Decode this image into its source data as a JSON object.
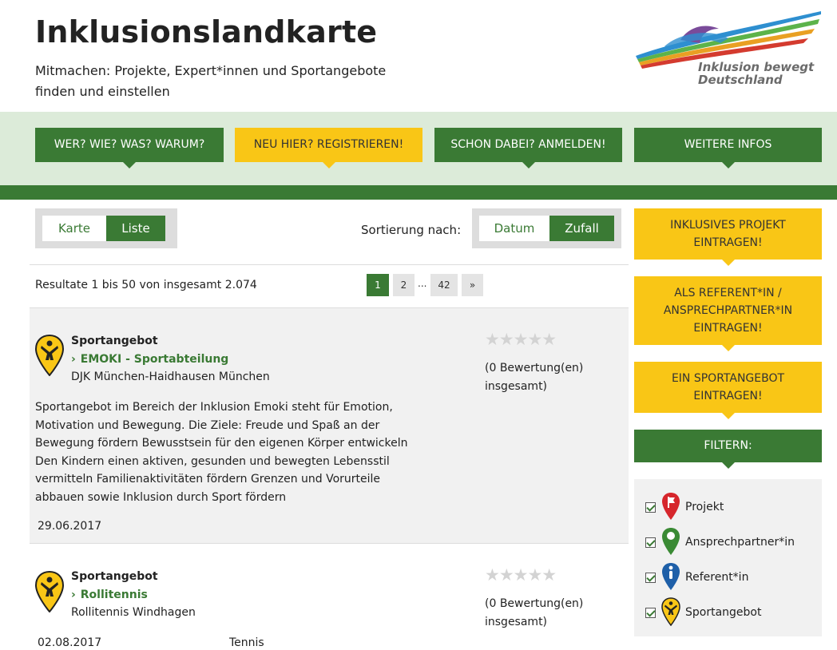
{
  "header": {
    "title": "Inklusionslandkarte",
    "subtitle": "Mitmachen: Projekte, Expert*innen und Sportangebote finden und einstellen",
    "logo_text_line1": "Inklusion bewegt",
    "logo_text_line2": "Deutschland"
  },
  "nav": {
    "items": [
      {
        "label": "WER? WIE? WAS? WARUM?"
      },
      {
        "label": "NEU HIER? REGISTRIEREN!"
      },
      {
        "label": "SCHON DABEI? ANMELDEN!"
      },
      {
        "label": "WEITERE INFOS"
      }
    ]
  },
  "view_toggle": {
    "map": "Karte",
    "list": "Liste",
    "active": "list"
  },
  "sort": {
    "label": "Sortierung nach:",
    "date": "Datum",
    "random": "Zufall",
    "active": "random"
  },
  "results": {
    "summary": "Resultate 1 bis 50 von insgesamt 2.074"
  },
  "pagination": {
    "pages": [
      "1",
      "2"
    ],
    "ellipsis": "...",
    "last": "42",
    "next": "»",
    "current": "1"
  },
  "listings": [
    {
      "type": "Sportangebot",
      "title": "EMOKI - Sportabteilung",
      "org": "DJK München-Haidhausen München",
      "description": "Sportangebot im Bereich der Inklusion Emoki steht für Emotion, Motivation und Bewegung. Die Ziele:    Freude und Spaß an der Bewegung fördern    Bewusstsein für den eigenen Körper entwickeln    Den Kindern einen aktiven, gesunden und bewegten Lebensstil vermitteln    Familienaktivitäten fördern    Grenzen und Vorurteile abbauen sowie Inklusion durch Sport fördern",
      "date": "29.06.2017",
      "stars": "★★★★★",
      "rating": "(0 Bewertung(en) insgesamt)",
      "rating_value": 0
    },
    {
      "type": "Sportangebot",
      "title": "Rollitennis",
      "org": "Rollitennis Windhagen",
      "date": "02.08.2017",
      "tag": "Tennis",
      "stars": "★★★★★",
      "rating": "(0 Bewertung(en) insgesamt)",
      "rating_value": 0
    }
  ],
  "sidebar": {
    "buttons": [
      {
        "label": "INKLUSIVES PROJEKT EINTRAGEN!"
      },
      {
        "label": "ALS REFERENT*IN / ANSPRECHPARTNER*IN EINTRAGEN!"
      },
      {
        "label": "EIN SPORTANGEBOT EINTRAGEN!"
      }
    ],
    "filter_title": "FILTERN:",
    "filters": [
      {
        "label": "Projekt",
        "icon": "projekt-pin-icon",
        "color": "#d6262c",
        "checked": true
      },
      {
        "label": "Ansprechpartner*in",
        "icon": "ansprechpartner-pin-icon",
        "color": "#3a8a34",
        "checked": true
      },
      {
        "label": "Referent*in",
        "icon": "referent-pin-icon",
        "color": "#1e5fa8",
        "checked": true
      },
      {
        "label": "Sportangebot",
        "icon": "sportangebot-pin-icon",
        "color": "#f9c616",
        "checked": true
      }
    ]
  },
  "colors": {
    "green": "#3a7a34",
    "yellow": "#f9c616",
    "light_green": "#dcebd9",
    "grey": "#f1f1f1"
  }
}
